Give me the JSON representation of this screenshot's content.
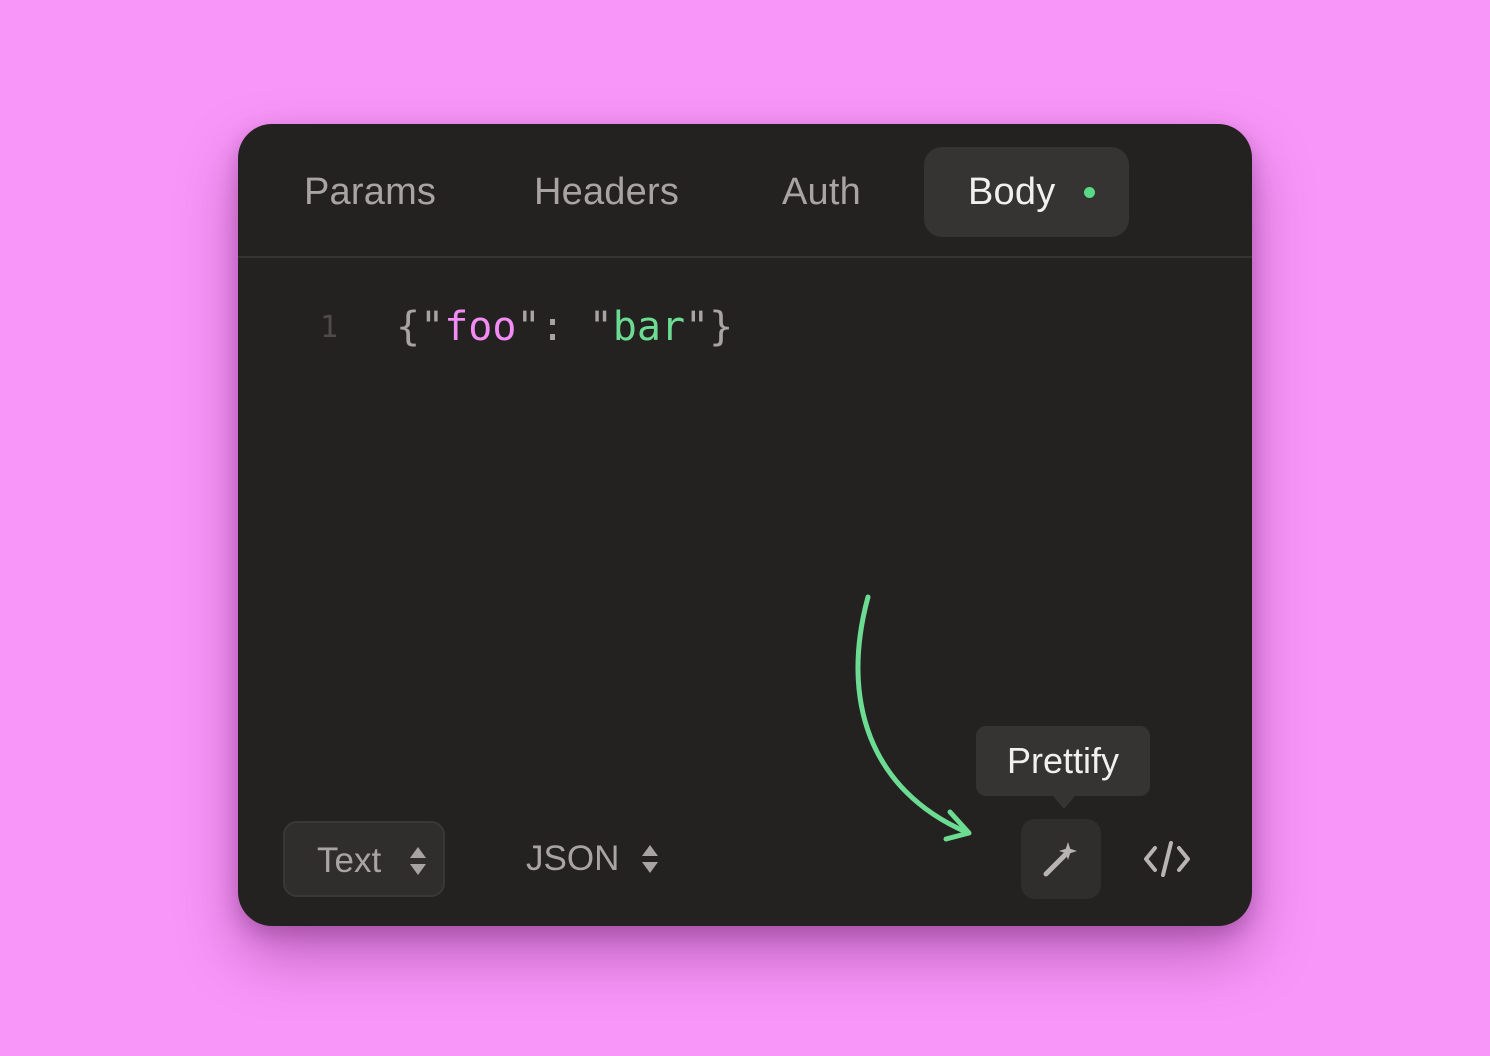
{
  "tabs": {
    "params": "Params",
    "headers": "Headers",
    "auth": "Auth",
    "body": "Body",
    "active": "Body"
  },
  "editor": {
    "line_number": "1",
    "tokens": {
      "open_brace": "{",
      "key_open_quote": "\"",
      "key": "foo",
      "key_close_quote_colon": "\": ",
      "value_open_quote": "\"",
      "value": "bar",
      "value_close_quote": "\"",
      "close_brace": "}"
    }
  },
  "toolbar": {
    "mode_select": "Text",
    "format_select": "JSON",
    "prettify_tooltip": "Prettify"
  },
  "icons": {
    "prettify": "magic-wand-icon",
    "code": "code-icon",
    "body_status": "green-dot"
  },
  "colors": {
    "background": "#f897f9",
    "panel": "#242221",
    "key": "#f38cf5",
    "string": "#6ddc93",
    "accent_green": "#57d985"
  }
}
